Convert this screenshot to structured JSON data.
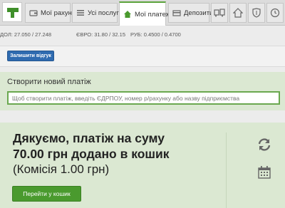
{
  "nav": {
    "tabs": [
      {
        "label": "Мої рахунки",
        "icon": "wallet-icon"
      },
      {
        "label": "Усі послуги",
        "icon": "list-icon"
      },
      {
        "label": "Мої платежі",
        "icon": "home-icon"
      },
      {
        "label": "Депозити",
        "icon": "deposit-icon"
      }
    ],
    "icon_buttons": [
      "transport-icon",
      "house-icon",
      "shield-icon",
      "timer-icon"
    ],
    "accent": "#5ba33b"
  },
  "rates": {
    "usd": "ДОЛ: 27.050 / 27.248",
    "eur": "ЄВРО: 31.80 / 32.15",
    "rub": "РУБ: 0.4500 / 0.4700"
  },
  "feedback": {
    "button_label": "Залишити відгук"
  },
  "new_payment": {
    "title": "Створити новий платіж",
    "placeholder": "Щоб створити платіж, введіть ЄДРПОУ, номер р/рахунку або назву підприємства"
  },
  "thanks": {
    "line1": "Дякуємо,  платіж на суму",
    "line2": "70.00 грн  додано в кошик",
    "line3": "(Комісія 1.00 грн)",
    "cart_button": "Перейти у кошик"
  },
  "colors": {
    "panel_green": "#dbe8d2",
    "button_green": "#4a9a2e",
    "button_blue": "#2f6bb0"
  }
}
